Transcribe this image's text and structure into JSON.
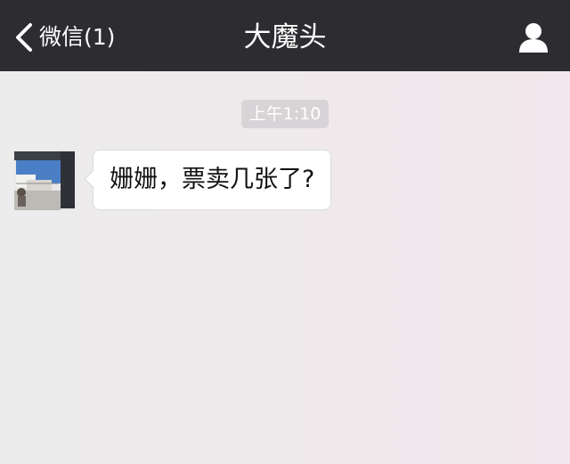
{
  "navbar": {
    "back_label": "微信(1)",
    "title": "大魔头",
    "back_icon": "chevron-left-icon",
    "profile_icon": "person-icon"
  },
  "chat": {
    "timestamp": "上午1:10",
    "messages": [
      {
        "direction": "incoming",
        "text": "姗姗，票卖几张了?"
      }
    ]
  },
  "colors": {
    "navbar_bg": "#2d2c31",
    "chat_bg": "#eeeaec",
    "bubble_bg": "#ffffff",
    "timestamp_bg": "#d8d3d6"
  }
}
